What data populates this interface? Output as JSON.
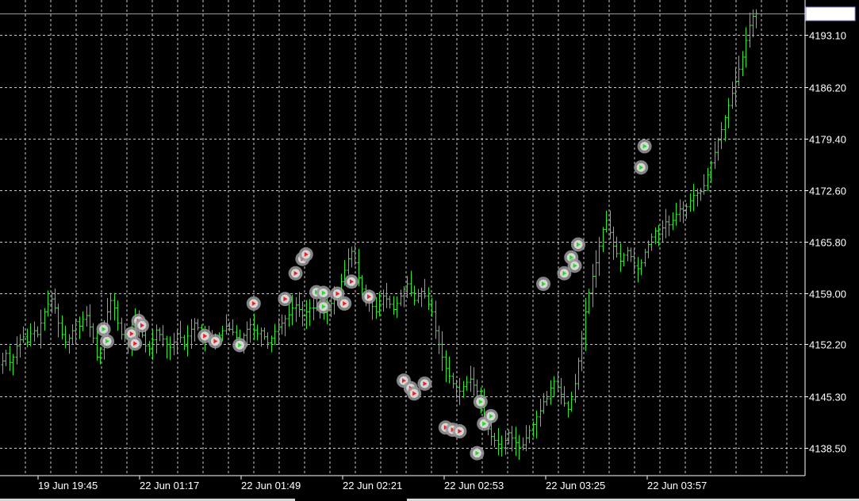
{
  "chart_data": {
    "type": "ohlc",
    "symbol_last_price": "4195.97",
    "colors": {
      "background": "#000000",
      "bars": "#2ee82e",
      "grid": "#c8c8c8",
      "axis_text": "#ffffff",
      "last_price_line": "#8a8fe0",
      "marker_ring": "#9a9a9a",
      "buy_arrow": "#22dd22",
      "sell_arrow": "#ee2222"
    },
    "y_ticks": [
      "4193.10",
      "4186.20",
      "4179.40",
      "4172.60",
      "4165.80",
      "4159.00",
      "4152.20",
      "4145.30",
      "4138.50"
    ],
    "y_tick_values": [
      4193.1,
      4186.2,
      4179.4,
      4172.6,
      4165.8,
      4159.0,
      4152.2,
      4145.3,
      4138.5
    ],
    "x_ticks": [
      "19 Jun 19:45",
      "22 Jun 01:17",
      "22 Jun 01:49",
      "22 Jun 02:21",
      "22 Jun 02:53",
      "22 Jun 03:25",
      "22 Jun 03:57"
    ],
    "ylim": [
      4135.0,
      4198.0
    ],
    "grid": true,
    "closes": [
      4150.0,
      4151.0,
      4149.8,
      4150.5,
      4152.0,
      4152.8,
      4153.2,
      4152.5,
      4153.6,
      4154.0,
      4153.5,
      4155.0,
      4156.5,
      4157.5,
      4158.2,
      4157.0,
      4155.0,
      4153.5,
      4152.5,
      4153.0,
      4154.0,
      4155.2,
      4154.6,
      4155.5,
      4156.0,
      4154.5,
      4153.0,
      4150.5,
      4151.5,
      4154.0,
      4156.5,
      4158.0,
      4157.0,
      4155.0,
      4153.5,
      4153.0,
      4152.5,
      4153.8,
      4155.2,
      4154.5,
      4153.4,
      4152.0,
      4151.6,
      4152.8,
      4154.1,
      4153.5,
      4152.9,
      4152.2,
      4151.8,
      4152.5,
      4153.6,
      4153.1,
      4152.0,
      4153.3,
      4154.2,
      4155.0,
      4154.4,
      4153.5,
      4152.9,
      4153.0,
      4152.6,
      4152.9,
      4153.4,
      4154.0,
      4154.6,
      4154.2,
      4153.8,
      4153.1,
      4152.5,
      4153.4,
      4154.2,
      4154.8,
      4154.1,
      4153.6,
      4154.0,
      4153.2,
      4152.4,
      4153.0,
      4153.9,
      4154.5,
      4155.0,
      4155.6,
      4156.1,
      4157.0,
      4157.4,
      4156.8,
      4156.0,
      4156.5,
      4157.0,
      4157.0,
      4157.2,
      4156.8,
      4156.4,
      4156.8,
      4157.6,
      4158.2,
      4159.0,
      4160.5,
      4162.0,
      4163.5,
      4164.5,
      4163.0,
      4161.0,
      4159.5,
      4158.6,
      4158.0,
      4157.2,
      4156.5,
      4157.5,
      4158.6,
      4158.2,
      4157.5,
      4156.8,
      4157.6,
      4158.6,
      4159.5,
      4160.2,
      4159.0,
      4158.0,
      4158.6,
      4159.2,
      4158.6,
      4157.5,
      4156.5,
      4154.0,
      4152.2,
      4150.5,
      4149.0,
      4148.0,
      4147.0,
      4146.5,
      4146.0,
      4146.6,
      4147.2,
      4147.6,
      4146.8,
      4146.0,
      4144.5,
      4142.5,
      4141.0,
      4140.0,
      4139.5,
      4139.0,
      4138.5,
      4139.5,
      4140.5,
      4139.8,
      4139.2,
      4138.6,
      4138.9,
      4139.8,
      4140.8,
      4141.6,
      4142.6,
      4143.4,
      4144.6,
      4145.0,
      4146.4,
      4147.3,
      4146.5,
      4145.6,
      4144.4,
      4143.6,
      4144.9,
      4147.0,
      4150.0,
      4153.0,
      4156.5,
      4159.0,
      4161.2,
      4163.0,
      4165.2,
      4167.4,
      4168.6,
      4167.0,
      4165.2,
      4164.2,
      4163.2,
      4164.0,
      4164.6,
      4163.8,
      4162.6,
      4162.2,
      4163.0,
      4164.4,
      4165.4,
      4166.4,
      4167.2,
      4166.8,
      4167.6,
      4168.4,
      4168.0,
      4168.6,
      4169.4,
      4170.1,
      4169.9,
      4170.4,
      4171.2,
      4171.9,
      4172.2,
      4172.4,
      4173.2,
      4174.6,
      4176.2,
      4177.6,
      4179.2,
      4180.6,
      4182.2,
      4183.8,
      4185.4,
      4187.0,
      4188.6,
      4190.2,
      4192.4,
      4194.4,
      4195.6,
      4195.97
    ],
    "trade_markers": [
      {
        "bar": 29,
        "price": 4154.2,
        "side": "buy"
      },
      {
        "bar": 30,
        "price": 4152.6,
        "side": "buy"
      },
      {
        "bar": 37,
        "price": 4153.6,
        "side": "sell"
      },
      {
        "bar": 38,
        "price": 4152.3,
        "side": "sell"
      },
      {
        "bar": 39,
        "price": 4155.3,
        "side": "sell"
      },
      {
        "bar": 40,
        "price": 4154.7,
        "side": "sell"
      },
      {
        "bar": 58,
        "price": 4153.3,
        "side": "sell"
      },
      {
        "bar": 61,
        "price": 4152.6,
        "side": "sell"
      },
      {
        "bar": 68,
        "price": 4152.1,
        "side": "buy"
      },
      {
        "bar": 72,
        "price": 4157.6,
        "side": "sell"
      },
      {
        "bar": 81,
        "price": 4158.2,
        "side": "sell"
      },
      {
        "bar": 84,
        "price": 4161.6,
        "side": "sell"
      },
      {
        "bar": 86,
        "price": 4163.5,
        "side": "sell"
      },
      {
        "bar": 87,
        "price": 4164.1,
        "side": "sell"
      },
      {
        "bar": 90,
        "price": 4159.1,
        "side": "buy"
      },
      {
        "bar": 92,
        "price": 4159.0,
        "side": "buy"
      },
      {
        "bar": 92,
        "price": 4157.2,
        "side": "buy"
      },
      {
        "bar": 96,
        "price": 4158.9,
        "side": "sell"
      },
      {
        "bar": 98,
        "price": 4157.6,
        "side": "sell"
      },
      {
        "bar": 100,
        "price": 4160.5,
        "side": "sell"
      },
      {
        "bar": 105,
        "price": 4158.5,
        "side": "sell"
      },
      {
        "bar": 115,
        "price": 4147.4,
        "side": "sell"
      },
      {
        "bar": 117,
        "price": 4146.4,
        "side": "sell"
      },
      {
        "bar": 118,
        "price": 4145.7,
        "side": "sell"
      },
      {
        "bar": 121,
        "price": 4147.0,
        "side": "sell"
      },
      {
        "bar": 127,
        "price": 4141.2,
        "side": "sell"
      },
      {
        "bar": 129,
        "price": 4140.9,
        "side": "sell"
      },
      {
        "bar": 131,
        "price": 4140.7,
        "side": "sell"
      },
      {
        "bar": 137,
        "price": 4144.6,
        "side": "buy"
      },
      {
        "bar": 138,
        "price": 4141.7,
        "side": "buy"
      },
      {
        "bar": 140,
        "price": 4142.7,
        "side": "buy"
      },
      {
        "bar": 136,
        "price": 4137.8,
        "side": "buy"
      },
      {
        "bar": 155,
        "price": 4160.2,
        "side": "buy"
      },
      {
        "bar": 161,
        "price": 4161.6,
        "side": "buy"
      },
      {
        "bar": 163,
        "price": 4163.7,
        "side": "buy"
      },
      {
        "bar": 164,
        "price": 4162.6,
        "side": "buy"
      },
      {
        "bar": 165,
        "price": 4165.4,
        "side": "buy"
      },
      {
        "bar": 183,
        "price": 4175.6,
        "side": "buy"
      },
      {
        "bar": 184,
        "price": 4178.4,
        "side": "buy"
      }
    ]
  }
}
